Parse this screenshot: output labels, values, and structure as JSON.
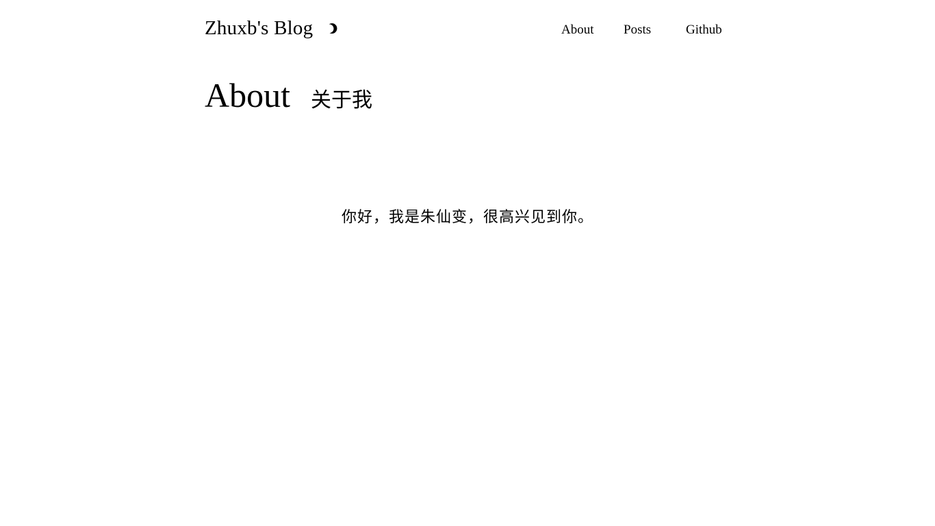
{
  "header": {
    "site_title": "Zhuxb's Blog",
    "theme_toggle_icon": "moon-icon"
  },
  "nav": {
    "items": [
      {
        "label": "About"
      },
      {
        "label": "Posts"
      },
      {
        "label": "Github"
      }
    ]
  },
  "page": {
    "title": "About",
    "subtitle": "关于我",
    "body": "你好，我是朱仙变，很高兴见到你。"
  }
}
